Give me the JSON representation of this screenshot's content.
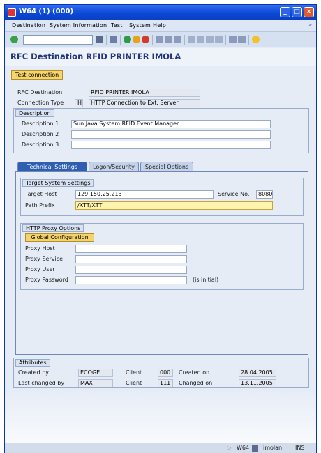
{
  "window": {
    "title": "W64 (1) (000)"
  },
  "menu": [
    "Destination",
    "System Information",
    "Test",
    "System",
    "Help"
  ],
  "screen_title": "RFC Destination RFID PRINTER IMOLA",
  "toolbar": {
    "test_connection": "Test connection"
  },
  "header": {
    "rfc_destination_label": "RFC Destination",
    "rfc_destination_value": "RFID PRINTER IMOLA",
    "connection_type_label": "Connection Type",
    "connection_type_code": "H",
    "connection_type_value": "HTTP Connection to Ext. Server"
  },
  "description_group": {
    "title": "Description",
    "description1_label": "Description 1",
    "description1_value": "Sun Java System RFID Event Manager",
    "description2_label": "Description 2",
    "description2_value": "",
    "description3_label": "Description 3",
    "description3_value": ""
  },
  "tabs": [
    "Technical Settings",
    "Logon/Security",
    "Special Options"
  ],
  "target_group": {
    "title": "Target System Settings",
    "target_host_label": "Target Host",
    "target_host_value": "129.150.25.213",
    "service_no_label": "Service No.",
    "service_no_value": "8080",
    "path_prefix_label": "Path Prefix",
    "path_prefix_value": "/XTT/XTT"
  },
  "proxy_group": {
    "title": "HTTP Proxy Options",
    "global_config_label": "Global Configuration",
    "proxy_host_label": "Proxy Host",
    "proxy_service_label": "Proxy Service",
    "proxy_user_label": "Proxy User",
    "proxy_password_label": "Proxy Password",
    "proxy_password_hint": "(is initial)"
  },
  "attributes_group": {
    "title": "Attributes",
    "created_by_label": "Created by",
    "created_by_value": "ECOGE",
    "client1_label": "Client",
    "client1_value": "000",
    "created_on_label": "Created on",
    "created_on_value": "28.04.2005",
    "last_changed_label": "Last changed by",
    "last_changed_value": "MAX",
    "client2_label": "Client",
    "client2_value": "111",
    "changed_on_label": "Changed on",
    "changed_on_value": "13.11.2005"
  },
  "status": {
    "system": "W64",
    "server": "imolan",
    "mode": "INS"
  },
  "colors": {
    "accent": "#2f5fb0",
    "title_text": "#21357a",
    "button": "#f6d56a"
  }
}
